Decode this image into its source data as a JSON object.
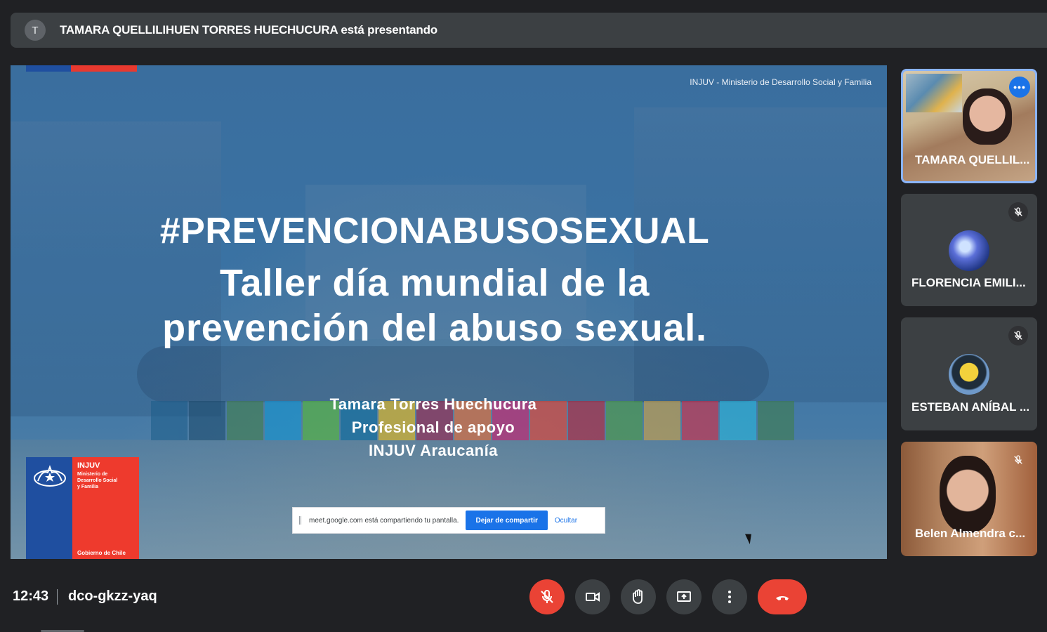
{
  "banner": {
    "avatar_letter": "T",
    "text": "TAMARA QUELLILIHUEN TORRES HUECHUCURA está presentando"
  },
  "slide": {
    "header": "INJUV - Ministerio de Desarrollo Social y Familia",
    "hashtag": "#PREVENCIONABUSOSEXUAL",
    "title_line1": "Taller día mundial de la",
    "title_line2": "prevención del abuso sexual.",
    "presenter_name": "Tamara Torres Huechucura",
    "presenter_role": "Profesional de apoyo",
    "presenter_org": "INJUV Araucanía",
    "logo": {
      "org": "INJUV",
      "ministry_line1": "Ministerio de",
      "ministry_line2": "Desarrollo Social",
      "ministry_line3": "y Familia",
      "government": "Gobierno de Chile"
    }
  },
  "share_bar": {
    "message": "meet.google.com está compartiendo tu pantalla.",
    "stop_label": "Dejar de compartir",
    "hide_label": "Ocultar"
  },
  "participants": [
    {
      "name": "TAMARA QUELLIL...",
      "muted": false,
      "active": true
    },
    {
      "name": "FLORENCIA EMILI...",
      "muted": true
    },
    {
      "name": "ESTEBAN ANÍBAL ...",
      "muted": true
    },
    {
      "name": "Belen Almendra c...",
      "muted": true
    }
  ],
  "bottom_bar": {
    "time": "12:43",
    "meeting_code": "dco-gkzz-yaq"
  },
  "colors": {
    "background": "#202124",
    "accent_blue": "#1a73e8",
    "danger_red": "#ea4335",
    "active_border": "#8ab4f8"
  },
  "icons": {
    "mic": "mic-off-icon",
    "camera": "camera-icon",
    "hand": "raise-hand-icon",
    "present": "present-screen-icon",
    "more": "more-vert-icon",
    "end": "end-call-icon"
  }
}
